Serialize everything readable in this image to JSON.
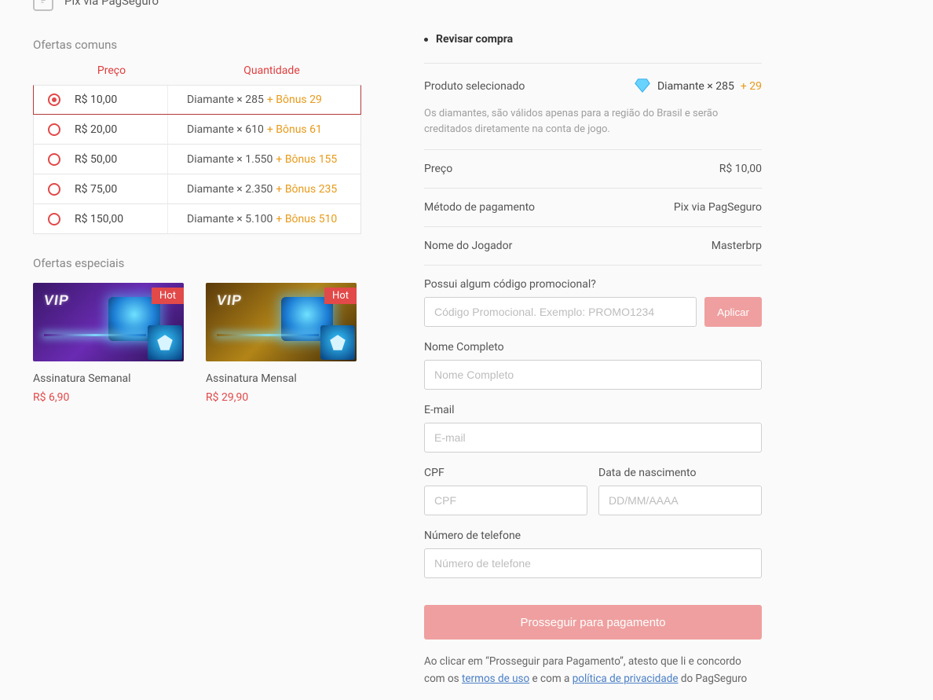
{
  "header": {
    "method": "Pix via PagSeguro"
  },
  "offers": {
    "section_title": "Ofertas comuns",
    "col_price": "Preço",
    "col_qty": "Quantidade",
    "rows": [
      {
        "price": "R$ 10,00",
        "qty": "Diamante × 285",
        "bonus": "+ Bônus 29",
        "selected": true
      },
      {
        "price": "R$ 20,00",
        "qty": "Diamante × 610",
        "bonus": "+ Bônus 61",
        "selected": false
      },
      {
        "price": "R$ 50,00",
        "qty": "Diamante × 1.550",
        "bonus": "+ Bônus 155",
        "selected": false
      },
      {
        "price": "R$ 75,00",
        "qty": "Diamante × 2.350",
        "bonus": "+ Bônus 235",
        "selected": false
      },
      {
        "price": "R$ 150,00",
        "qty": "Diamante × 5.100",
        "bonus": "+ Bônus 510",
        "selected": false
      }
    ]
  },
  "special": {
    "section_title": "Ofertas especiais",
    "hot_label": "Hot",
    "items": [
      {
        "name": "Assinatura Semanal",
        "price": "R$ 6,90"
      },
      {
        "name": "Assinatura Mensal",
        "price": "R$ 29,90"
      }
    ]
  },
  "review": {
    "title": "Revisar compra",
    "product_label": "Produto selecionado",
    "product_value": "Diamante × 285",
    "product_bonus": "+ 29",
    "product_note": "Os diamantes, são válidos apenas para a região do Brasil e serão creditados diretamente na conta de jogo.",
    "price_label": "Preço",
    "price_value": "R$ 10,00",
    "method_label": "Método de pagamento",
    "method_value": "Pix via PagSeguro",
    "player_label": "Nome do Jogador",
    "player_value": "Masterbrp",
    "promo_label": "Possui algum código promocional?",
    "promo_placeholder": "Código Promocional. Exemplo: PROMO1234",
    "promo_apply": "Aplicar",
    "name_label": "Nome Completo",
    "name_placeholder": "Nome Completo",
    "email_label": "E-mail",
    "email_placeholder": "E-mail",
    "cpf_label": "CPF",
    "cpf_placeholder": "CPF",
    "dob_label": "Data de nascimento",
    "dob_placeholder": "DD/MM/AAAA",
    "phone_label": "Número de telefone",
    "phone_placeholder": "Número de telefone",
    "proceed_btn": "Prosseguir para pagamento",
    "terms_pre": "Ao clicar em “Prosseguir para Pagamento”, atesto que li e concordo com os ",
    "terms_link1": "termos de uso",
    "terms_mid": " e com a ",
    "terms_link2": "política de privacidade",
    "terms_post": " do PagSeguro"
  }
}
